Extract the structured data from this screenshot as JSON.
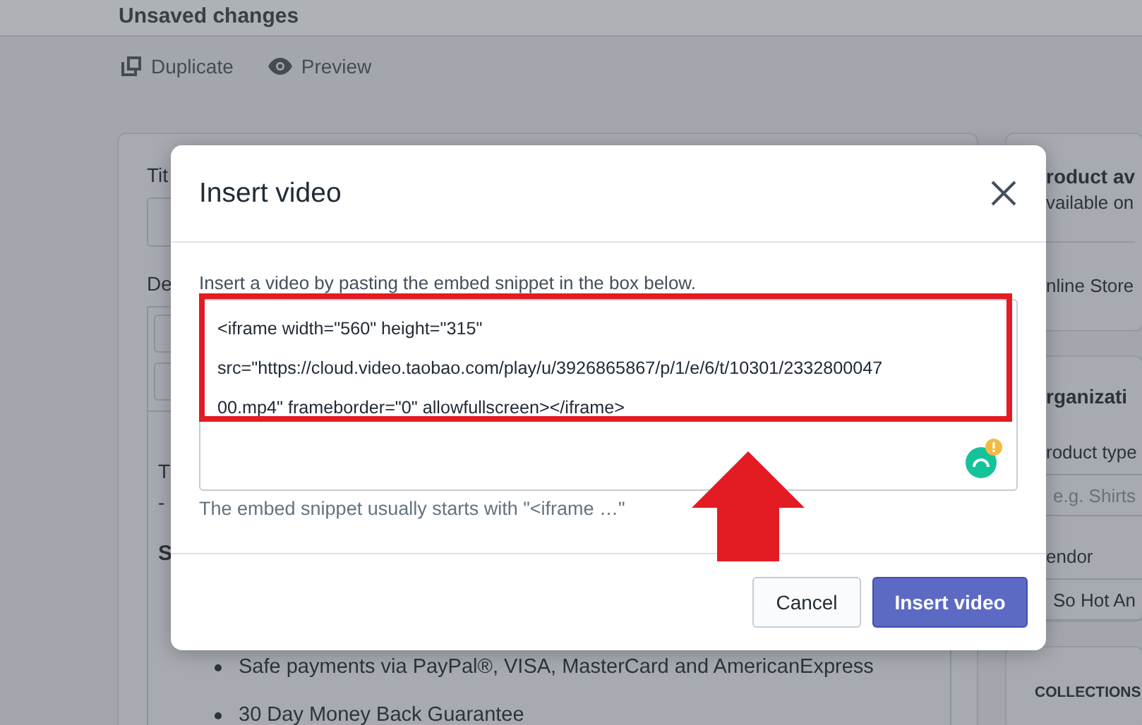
{
  "top_bar": {
    "title": "Unsaved changes"
  },
  "actions": [
    {
      "kind": "duplicate",
      "label": "Duplicate"
    },
    {
      "kind": "preview",
      "label": "Preview"
    }
  ],
  "product_card": {
    "title_label": "Tit",
    "description_label": "De",
    "description_lines": [
      {
        "kind": "text",
        "text": "T"
      },
      {
        "kind": "text",
        "text": "-"
      },
      {
        "kind": "heading",
        "text": "S"
      },
      {
        "kind": "bullet",
        "text": "Safe payments via PayPal®, VISA, MasterCard and AmericanExpress"
      },
      {
        "kind": "bullet",
        "text": "30 Day Money Back Guarantee"
      }
    ]
  },
  "availability": {
    "title": "roduct av",
    "subtitle": "vailable on",
    "channel": "nline Store"
  },
  "organization": {
    "title": "rganizati",
    "product_type_label": "roduct type",
    "product_type_placeholder": "e.g. Shirts",
    "vendor_label": "endor",
    "vendor_value": "So Hot An"
  },
  "collections": {
    "title": "COLLECTIONS"
  },
  "modal": {
    "title": "Insert video",
    "instructions": "Insert a video by pasting the embed snippet in the box below.",
    "snippet_lines": [
      "<iframe width=\"560\" height=\"315\"",
      "src=\"https://cloud.video.taobao.com/play/u/3926865867/p/1/e/6/t/10301/2332800047",
      "00.mp4\" frameborder=\"0\" allowfullscreen></iframe>"
    ],
    "help": "The embed snippet usually starts with \"<iframe …\"",
    "buttons": [
      {
        "kind": "secondary",
        "label": "Cancel"
      },
      {
        "kind": "primary",
        "label": "Insert video"
      }
    ]
  }
}
